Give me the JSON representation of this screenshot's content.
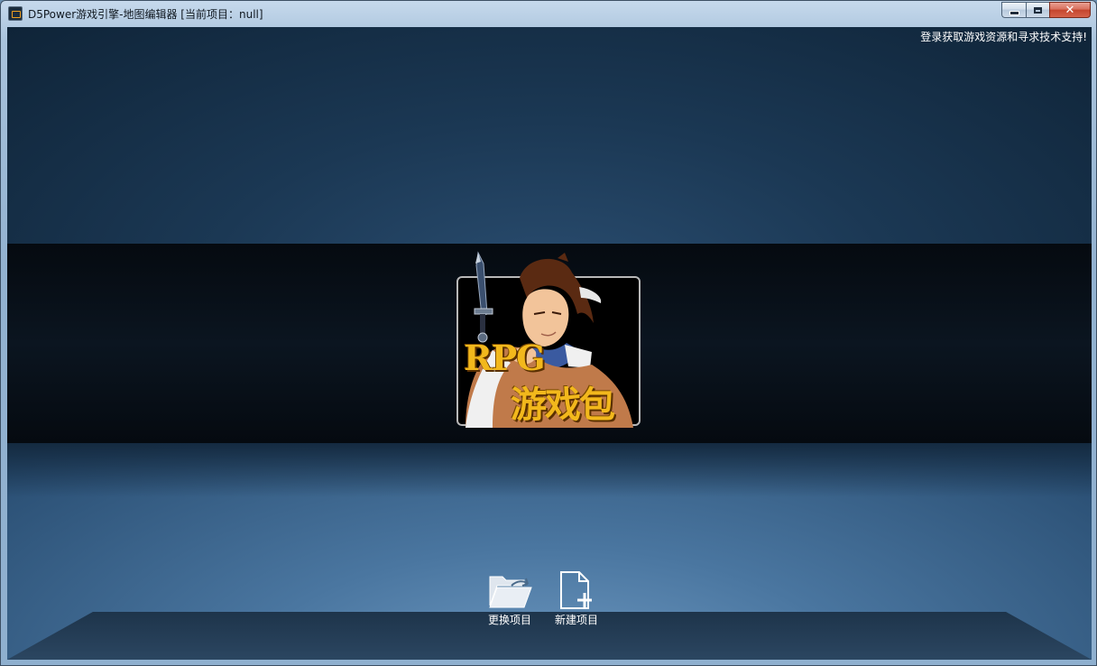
{
  "window": {
    "title": "D5Power游戏引擎-地图编辑器 [当前项目：null]",
    "controls": {
      "minimize": "minimize-icon",
      "maximize": "maximize-icon",
      "close": "close-icon"
    }
  },
  "header": {
    "login_link": "登录获取游戏资源和寻求技术支持!"
  },
  "logo": {
    "text_en": "RPG",
    "text_cn": "游戏包"
  },
  "actions": [
    {
      "label": "更换项目",
      "icon": "folder-open-icon"
    },
    {
      "label": "新建项目",
      "icon": "new-file-icon"
    }
  ],
  "colors": {
    "accent_gold": "#f2b81c",
    "background_dark": "#0b1520",
    "background_blue": "#1b3854"
  }
}
